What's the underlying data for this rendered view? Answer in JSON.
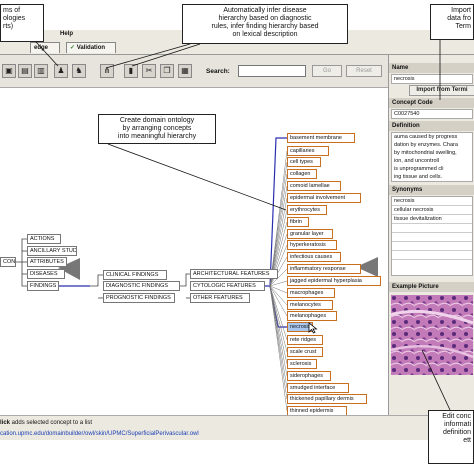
{
  "menu": {
    "help": "Help"
  },
  "tabs": {
    "knowledge": "edge",
    "validation": "Validation"
  },
  "toolbar": {
    "search_label": "Search:",
    "go": "Go",
    "reset": "Reset"
  },
  "tree": {
    "roots": [
      "CONCEPTS"
    ],
    "level1": [
      "ACTIONS",
      "ANCILLARY STUDIES",
      "ATTRIBUTES",
      "DISEASES",
      "FINDINGS"
    ],
    "findings": [
      "CLINICAL FINDINGS",
      "DIAGNOSTIC FINDINGS",
      "PROGNOSTIC FINDINGS"
    ],
    "diagnostic": [
      "ARCHITECTURAL FEATURES",
      "CYTOLOGIC FEATURES",
      "OTHER FEATURES"
    ],
    "cytologic": [
      "basement membrane",
      "capillaries",
      "cell types",
      "collagen",
      "comoid lamellae",
      "epidermal involvement",
      "erythrocytes",
      "fibrin",
      "granular layer",
      "hyperkeratosis",
      "infectious causes",
      "inflammatory response",
      "jagged epidermal hyperplasia",
      "macrophages",
      "melanocytes",
      "melanophages",
      "necrosis",
      "rete ridges",
      "scale crust",
      "sclerosis",
      "siderophages",
      "smudged interface",
      "thickened papillary dermis",
      "thinned epidermis"
    ],
    "selected": "necrosis"
  },
  "panel": {
    "name_label": "Name",
    "name_value": "necrosis",
    "import_button": "Import from Termi",
    "code_label": "Concept Code",
    "code_value": "C0027540",
    "definition_label": "Definition",
    "definition_text": [
      "auma caused by progress",
      "dation by enzymes. Chara",
      "by mitochondrial swelling,",
      "ion, and uncontroll",
      "is unprogrammed cli",
      "ing tissue and cells."
    ],
    "synonyms_label": "Synonyms",
    "synonyms": [
      "necrosis",
      "cellular necrosis",
      "tissue devitalization"
    ],
    "picture_label": "Example Picture"
  },
  "status": {
    "hint_bold": "lick",
    "hint_text": " adds selected concept to a list",
    "url": "cation.upmc.edu/domainbuilder/owl/skin/UPMC/SuperficialPerivascular.owl"
  },
  "callouts": {
    "top_left": [
      "ms of",
      "ologies",
      "rts)"
    ],
    "top_mid": [
      "Automatically infer disease",
      "hierarchy based on diagnostic",
      "rules, infer finding hierarchy based",
      "on lexical description"
    ],
    "top_right": [
      "Import",
      "data fro",
      "Term"
    ],
    "mid": [
      "Create domain ontology",
      "by arranging concepts",
      "into meaningful hierarchy"
    ],
    "bottom_right": [
      "Edit conc",
      "informati",
      "definition",
      "ett"
    ]
  },
  "colors": {
    "accent": "#c87020",
    "selected": "#a9c6ee",
    "tree_line": "#2a2fb0"
  }
}
